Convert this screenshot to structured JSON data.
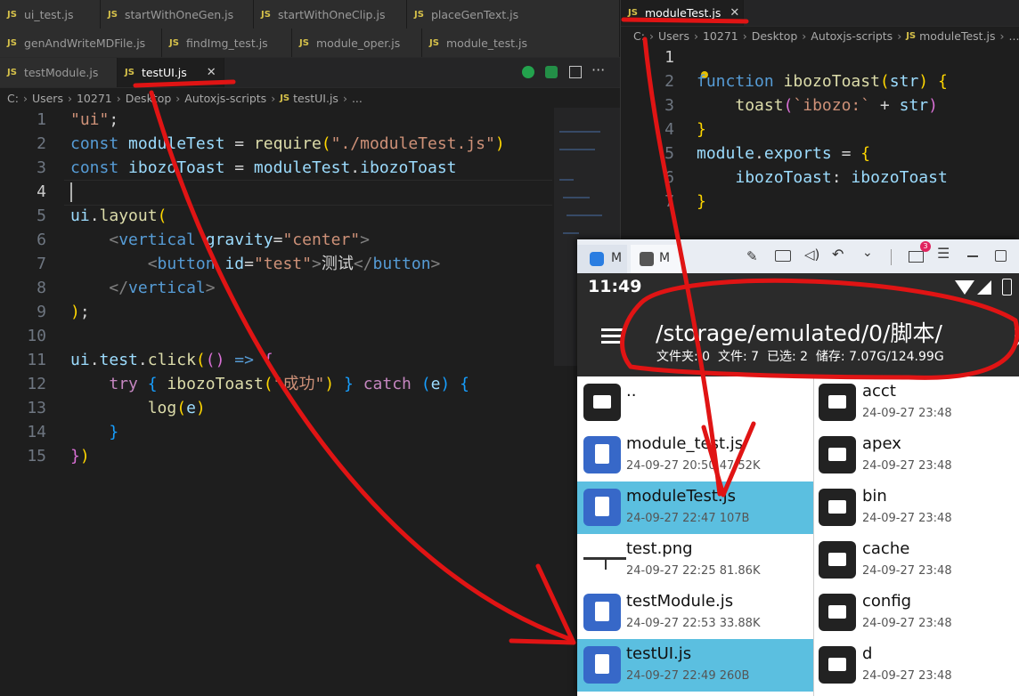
{
  "left_editor": {
    "tabs_row1": [
      "ui_test.js",
      "startWithOneGen.js",
      "startWithOneClip.js",
      "placeGenText.js"
    ],
    "tabs_row2": [
      "genAndWriteMDFile.js",
      "findImg_test.js",
      "module_oper.js",
      "module_test.js"
    ],
    "tabs_row3": [
      "testModule.js",
      "testUI.js"
    ],
    "breadcrumb": [
      "C:",
      "Users",
      "10271",
      "Desktop",
      "Autoxjs-scripts",
      "testUI.js",
      "..."
    ],
    "line_numbers": [
      "1",
      "2",
      "3",
      "4",
      "5",
      "6",
      "7",
      "8",
      "9",
      "10",
      "11",
      "12",
      "13",
      "14",
      "15"
    ]
  },
  "right_editor": {
    "tab": "moduleTest.js",
    "breadcrumb": [
      "C:",
      "Users",
      "10271",
      "Desktop",
      "Autoxjs-scripts",
      "moduleTest.js",
      "..."
    ],
    "line_numbers": [
      "1",
      "2",
      "3",
      "4",
      "5",
      "6",
      "7"
    ]
  },
  "phone": {
    "tab1": "M",
    "tab2": "M",
    "mail_badge": "3",
    "time": "11:49",
    "path": "/storage/emulated/0/脚本/",
    "summary": "文件夹: 0  文件: 7  已选: 2  储存: 7.07G/124.99G",
    "files": [
      {
        "name": "..",
        "meta": "",
        "type": "folder",
        "selected": false
      },
      {
        "name": "module_test.js",
        "meta": "24-09-27 20:50  47.52K",
        "type": "js",
        "selected": false
      },
      {
        "name": "moduleTest.js",
        "meta": "24-09-27 22:47  107B",
        "type": "js",
        "selected": true
      },
      {
        "name": "test.png",
        "meta": "24-09-27 22:25  81.86K",
        "type": "png",
        "selected": false
      },
      {
        "name": "testModule.js",
        "meta": "24-09-27 22:53  33.88K",
        "type": "js",
        "selected": false
      },
      {
        "name": "testUI.js",
        "meta": "24-09-27 22:49  260B",
        "type": "js",
        "selected": true
      }
    ],
    "folders": [
      {
        "name": "acct",
        "meta": "24-09-27 23:48"
      },
      {
        "name": "apex",
        "meta": "24-09-27 23:48"
      },
      {
        "name": "bin",
        "meta": "24-09-27 23:48"
      },
      {
        "name": "cache",
        "meta": "24-09-27 23:48"
      },
      {
        "name": "config",
        "meta": "24-09-27 23:48"
      },
      {
        "name": "d",
        "meta": "24-09-27 23:48"
      }
    ]
  },
  "colors": {
    "selected_row": "#5bbfe0",
    "annotation": "#e01414",
    "js_icon": "#3768c8"
  }
}
